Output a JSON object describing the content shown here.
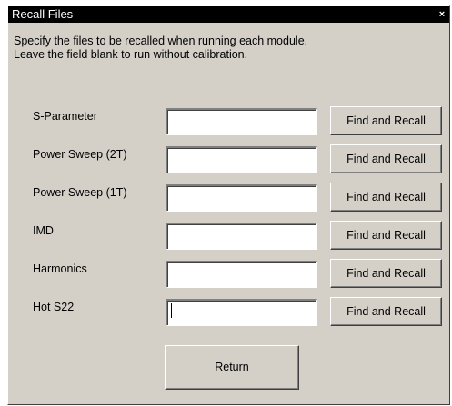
{
  "window": {
    "title": "Recall Files",
    "close_glyph": "×",
    "close_icon": "close-icon"
  },
  "instructions": {
    "line1": "Specify the files to be recalled when running each module.",
    "line2": "Leave the field blank to run without calibration."
  },
  "rows": [
    {
      "label": "S-Parameter",
      "value": "",
      "button": "Find and Recall"
    },
    {
      "label": "Power Sweep (2T)",
      "value": "",
      "button": "Find and Recall"
    },
    {
      "label": "Power Sweep (1T)",
      "value": "",
      "button": "Find and Recall"
    },
    {
      "label": "IMD",
      "value": "",
      "button": "Find and Recall"
    },
    {
      "label": "Harmonics",
      "value": "",
      "button": "Find and Recall"
    },
    {
      "label": "Hot S22",
      "value": "",
      "button": "Find and Recall"
    }
  ],
  "actions": {
    "return_label": "Return"
  },
  "colors": {
    "dialog_bg": "#d4d0c8",
    "titlebar_bg": "#000000",
    "titlebar_text": "#ffffff"
  }
}
